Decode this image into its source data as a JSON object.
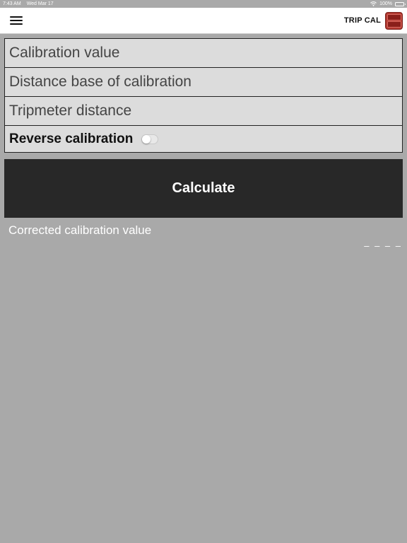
{
  "status_bar": {
    "time": "7:43 AM",
    "date": "Wed Mar 17",
    "battery": "100%",
    "battery_level": 1.0
  },
  "nav": {
    "title": "TRIP CAL",
    "menu_icon": "hamburger-icon",
    "app_icon": "app-logo-icon"
  },
  "form": {
    "calibration_value_placeholder": "Calibration value",
    "distance_base_placeholder": "Distance base of calibration",
    "tripmeter_distance_placeholder": "Tripmeter distance",
    "reverse_calibration_label": "Reverse calibration",
    "reverse_calibration_on": false
  },
  "actions": {
    "calculate_label": "Calculate"
  },
  "result": {
    "label": "Corrected calibration value",
    "value": "– – – –"
  },
  "colors": {
    "background": "#a9a9a9",
    "field_background": "#dcdcdc",
    "button_background": "#282828",
    "app_icon_red": "#b23a32"
  }
}
